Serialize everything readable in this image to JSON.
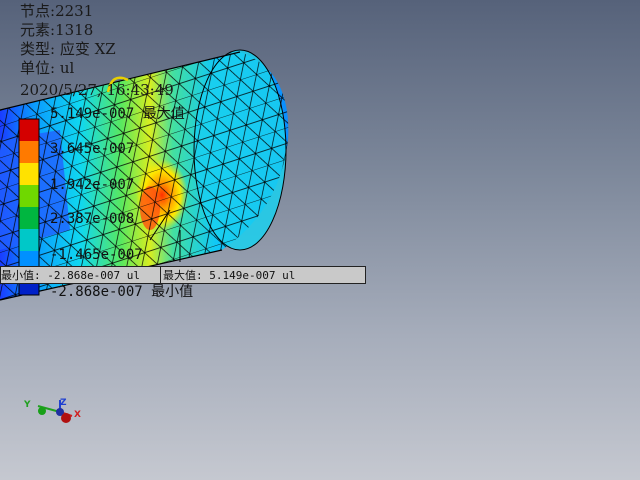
{
  "info": {
    "node_label": "节点",
    "node_value": "2231",
    "element_label": "元素",
    "element_value": "1318",
    "type_label": "类型",
    "type_value": "应变 XZ",
    "unit_label": "单位",
    "unit_value": "ul",
    "timestamp": "2020/5/27, 16:43:49"
  },
  "legend": {
    "max_text": "5.149e-007 最大值",
    "level_3": "3.645e-007",
    "level_2": "1.942e-007",
    "level_1": "2.387e-008",
    "level_0": "-1.465e-007",
    "min_text": "-2.868e-007 最小值",
    "colors": [
      "#d40000",
      "#ff7a00",
      "#ffe200",
      "#6fd800",
      "#00b640",
      "#00c8c8",
      "#0090ff",
      "#0020c8"
    ]
  },
  "probes": {
    "min_probe": "最小值: -2.868e-007 ul",
    "max_probe": "最大值: 5.149e-007 ul"
  },
  "triad": {
    "x": "X",
    "y": "Y",
    "z": "Z",
    "x_color": "#d02020",
    "y_color": "#20a020",
    "z_color": "#2040d0"
  }
}
